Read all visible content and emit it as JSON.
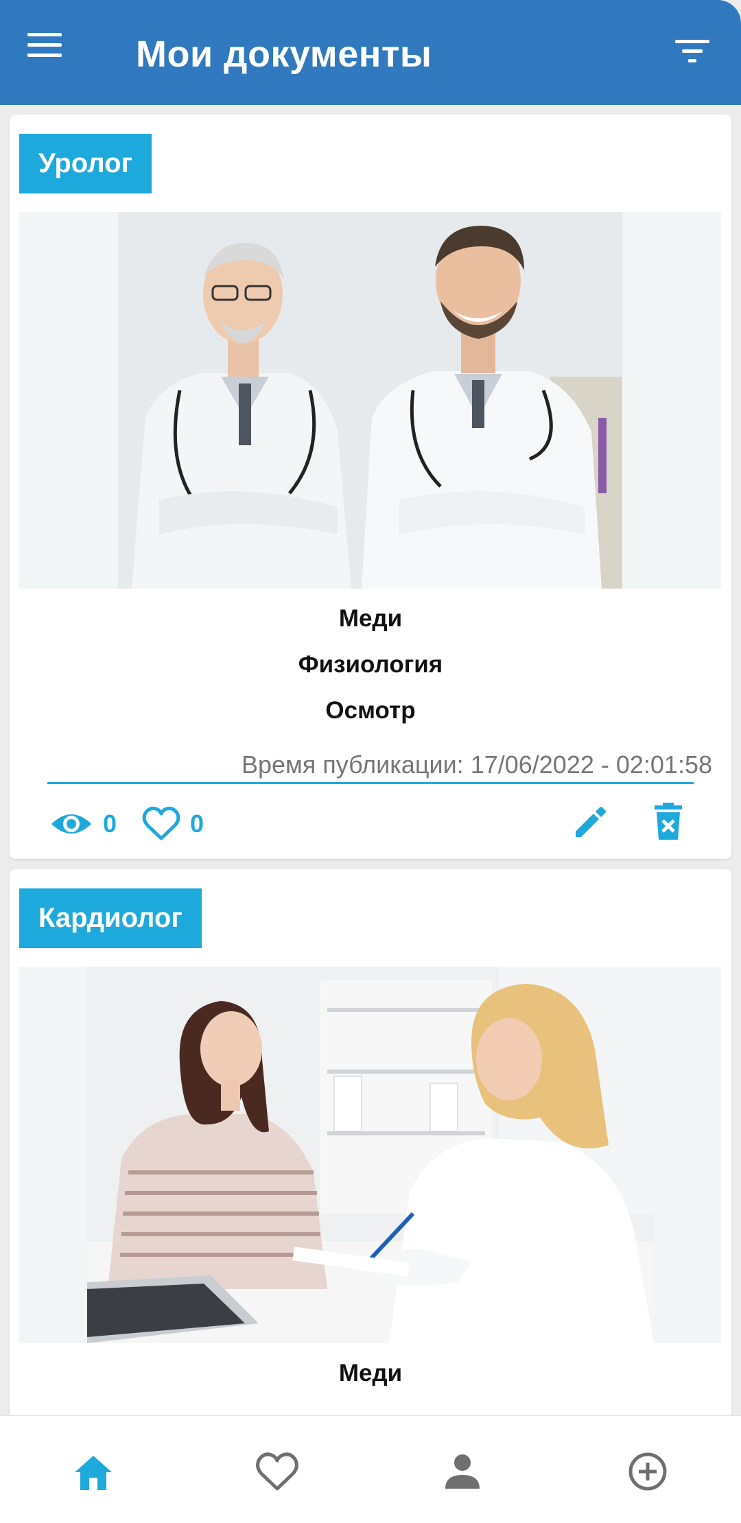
{
  "header": {
    "title": "Мои документы",
    "background": "#3179be",
    "menu_icon": "hamburger-menu-icon",
    "filter_icon": "filter-list-icon"
  },
  "accent_color": "#1ea9dd",
  "documents": [
    {
      "category": "Уролог",
      "image": "two-doctors-photo",
      "lines": [
        "Меди",
        "Физиология",
        "Осмотр"
      ],
      "published": "Время публикации: 17/06/2022 - 02:01:58",
      "views": "0",
      "likes": "0"
    },
    {
      "category": "Кардиолог",
      "image": "doctor-patient-consultation-photo",
      "lines": [
        "Меди"
      ]
    }
  ],
  "bottom_nav": [
    {
      "icon": "home-icon",
      "active": true
    },
    {
      "icon": "heart-icon",
      "active": false
    },
    {
      "icon": "person-icon",
      "active": false
    },
    {
      "icon": "add-circle-icon",
      "active": false
    }
  ]
}
